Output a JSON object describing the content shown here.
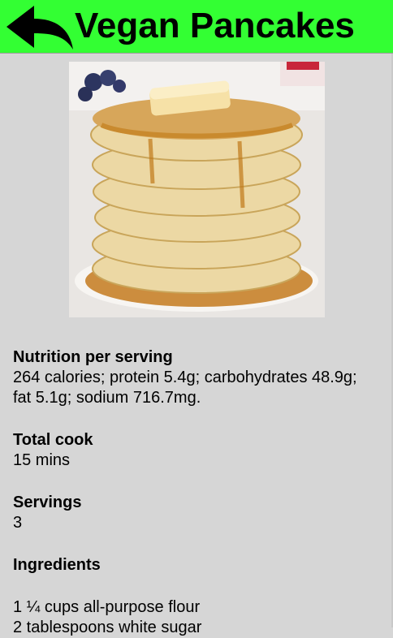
{
  "header": {
    "title": "Vegan Pancakes",
    "back_icon": "back-arrow-icon",
    "bg_color": "#33ff33"
  },
  "image": {
    "alt": "pancakes-photo"
  },
  "sections": {
    "nutrition": {
      "heading": "Nutrition per serving",
      "text": "264 calories; protein 5.4g; carbohydrates 48.9g; fat 5.1g; sodium 716.7mg."
    },
    "total_cook": {
      "heading": "Total cook",
      "text": "15 mins"
    },
    "servings": {
      "heading": "Servings",
      "text": "3"
    },
    "ingredients": {
      "heading": "Ingredients",
      "items": [
        "1 ¼ cups all-purpose flour",
        "2 tablespoons white sugar"
      ]
    }
  }
}
